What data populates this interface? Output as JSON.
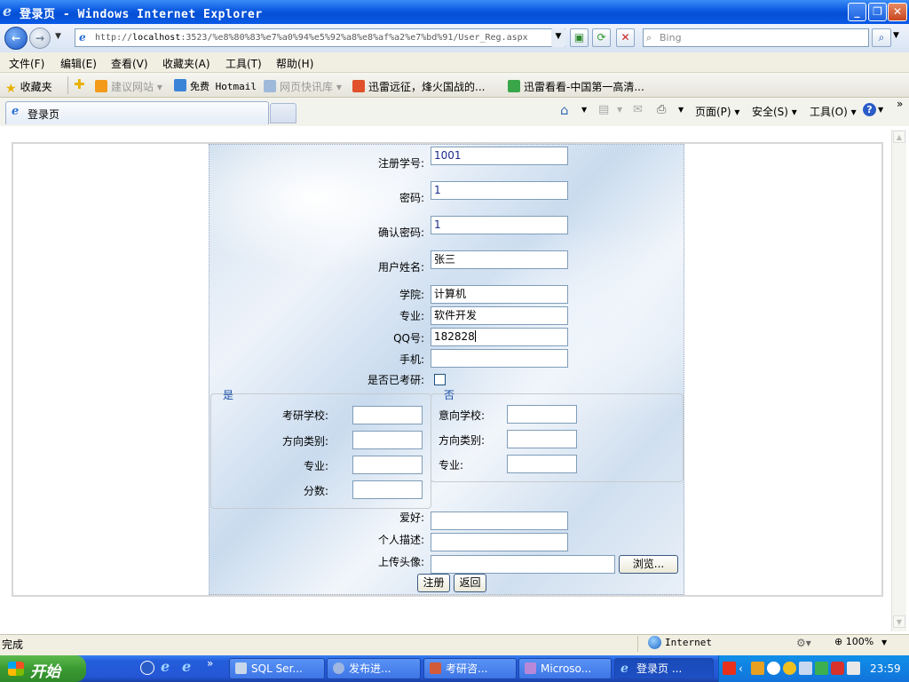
{
  "window": {
    "title": "登录页 - Windows Internet Explorer",
    "minimize": "_",
    "maximize": "❐",
    "close": "✕"
  },
  "address": {
    "url_prefix": "http://",
    "url_host": "localhost",
    "url_rest": ":3523/%e8%80%83%e7%a0%94%e5%92%a8%e8%af%a2%e7%bd%91/User_Reg.aspx",
    "search_placeholder": "Bing"
  },
  "menu": [
    "文件(F)",
    "编辑(E)",
    "查看(V)",
    "收藏夹(A)",
    "工具(T)",
    "帮助(H)"
  ],
  "favorites": {
    "label": "收藏夹",
    "items": [
      "建议网站 ▾",
      "免费 Hotmail",
      "网页快讯库 ▾",
      "迅雷远征，烽火国战的...",
      "迅雷看看-中国第一高清..."
    ]
  },
  "tab": {
    "title": "登录页"
  },
  "commandbar": {
    "page": "页面(P) ▾",
    "safety": "安全(S) ▾",
    "tools": "工具(O) ▾",
    "more": "»"
  },
  "form": {
    "student_id_label": "注册学号:",
    "student_id_value": "1001",
    "password_label": "密码:",
    "password_value": "1",
    "confirm_label": "确认密码:",
    "confirm_value": "1",
    "name_label": "用户姓名:",
    "name_value": "张三",
    "college_label": "学院:",
    "college_value": "计算机",
    "major_label": "专业:",
    "major_value": "软件开发",
    "qq_label": "QQ号:",
    "qq_value": "182828",
    "phone_label": "手机:",
    "phone_value": "",
    "postgrad_label": "是否已考研:",
    "yes_group": {
      "legend": "是",
      "school_label": "考研学校:",
      "direction_label": "方向类别:",
      "major_label": "专业:",
      "score_label": "分数:"
    },
    "no_group": {
      "legend": "否",
      "school_label": "意向学校:",
      "direction_label": "方向类别:",
      "major_label": "专业:"
    },
    "hobby_label": "爱好:",
    "desc_label": "个人描述:",
    "avatar_label": "上传头像:",
    "browse_button": "浏览...",
    "register_button": "注册",
    "back_button": "返回"
  },
  "status": {
    "text": "完成",
    "zone": "Internet",
    "zoom": "100%"
  },
  "taskbar": {
    "start": "开始",
    "tasks": [
      "SQL Ser...",
      "发布进...",
      "考研咨...",
      "Microso...",
      "登录页 ..."
    ],
    "clock": "23:59"
  }
}
